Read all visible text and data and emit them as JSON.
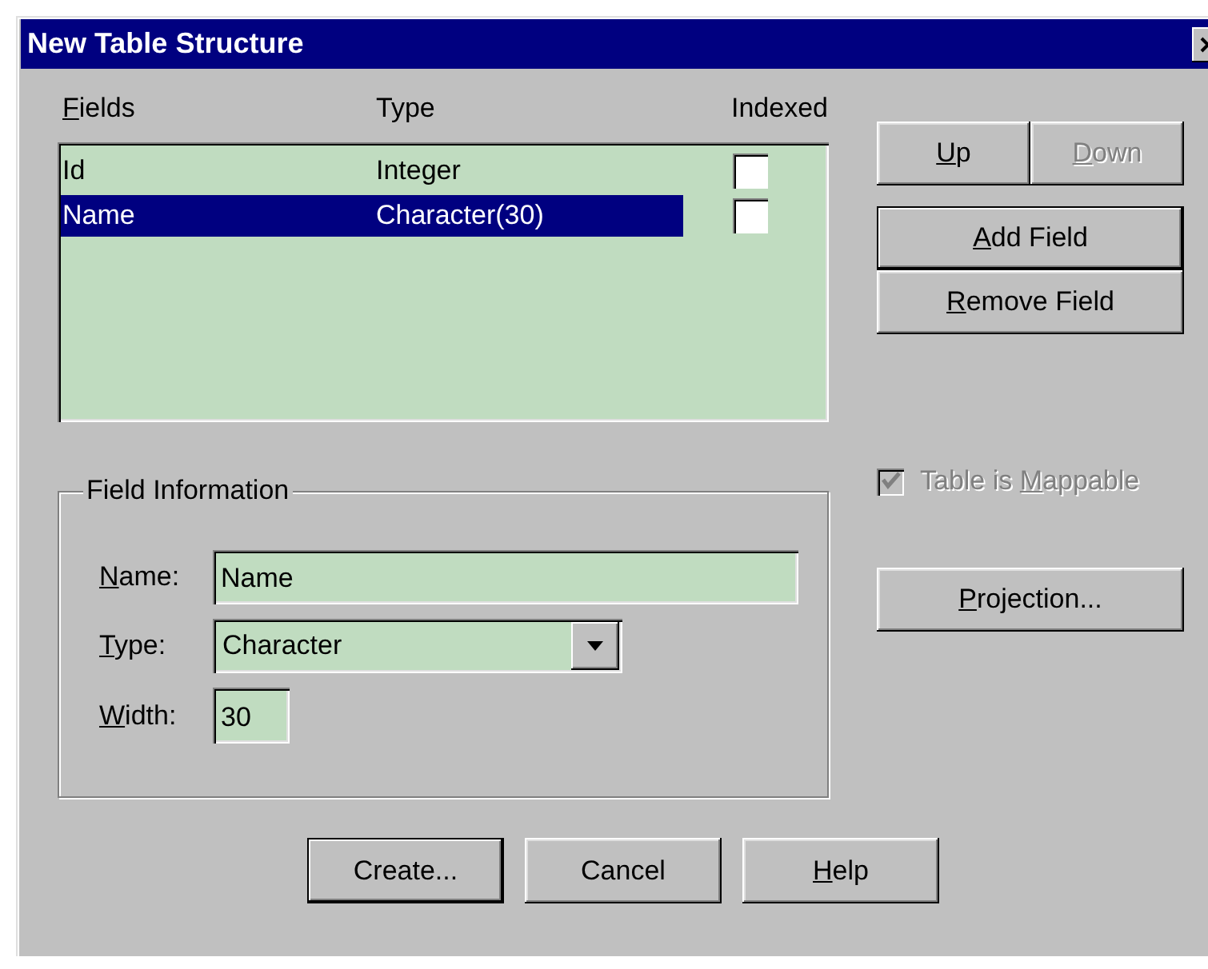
{
  "window": {
    "title": "New Table Structure"
  },
  "fields_list": {
    "columns": [
      {
        "key": "F",
        "after": "ields"
      },
      {
        "before": "Type"
      },
      {
        "before": "Indexed"
      }
    ],
    "rows": [
      {
        "name": "Id",
        "type": "Integer",
        "indexed": false,
        "selected": false
      },
      {
        "name": "Name",
        "type": "Character(30)",
        "indexed": false,
        "selected": true
      }
    ]
  },
  "side_buttons": [
    {
      "key": "U",
      "after": "p",
      "disabled": false,
      "default": false
    },
    {
      "key": "D",
      "after": "own",
      "disabled": true,
      "default": false
    },
    {
      "key": "A",
      "after": "dd Field",
      "disabled": false,
      "default": true
    },
    {
      "key": "R",
      "after": "emove Field",
      "disabled": false,
      "default": false
    }
  ],
  "field_information": {
    "title": "Field Information",
    "name": {
      "label": {
        "key": "N",
        "after": "ame:"
      },
      "value": "Name"
    },
    "type": {
      "label": {
        "key": "T",
        "after": "ype:"
      },
      "value": "Character"
    },
    "width": {
      "label": {
        "key": "W",
        "after": "idth:"
      },
      "value": "30"
    }
  },
  "mappable": {
    "label": {
      "before": "Table is ",
      "key": "M",
      "after": "appable"
    },
    "checked": true,
    "disabled": true
  },
  "projection_button": {
    "key": "P",
    "after": "rojection...",
    "disabled": false,
    "default": false
  },
  "bottom_buttons": [
    {
      "before": "Create...",
      "disabled": false,
      "default": true
    },
    {
      "before": "Cancel",
      "disabled": false,
      "default": false
    },
    {
      "key": "H",
      "after": "elp",
      "disabled": false,
      "default": false
    }
  ]
}
